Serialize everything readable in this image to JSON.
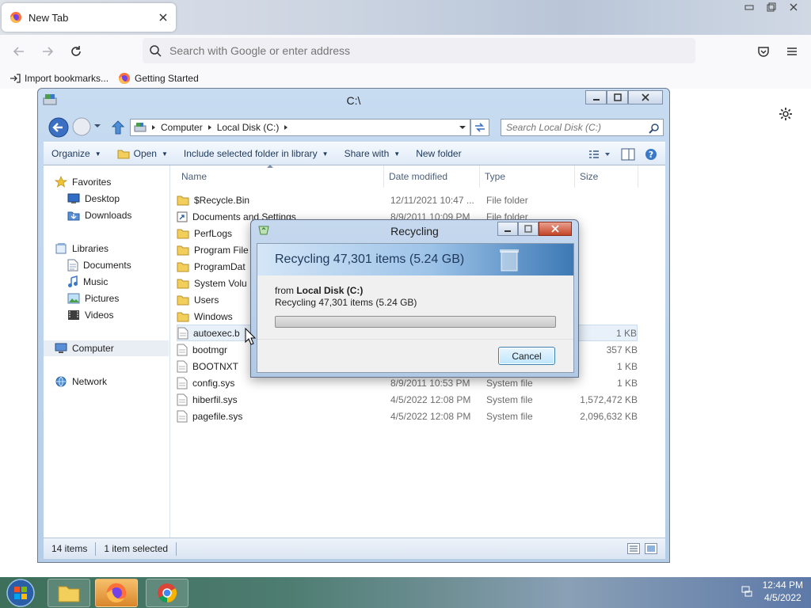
{
  "browser": {
    "tab_title": "New Tab",
    "url_placeholder": "Search with Google or enter address",
    "bookmarks": [
      {
        "label": "Import bookmarks..."
      },
      {
        "label": "Getting Started"
      }
    ]
  },
  "explorer": {
    "title": "C:\\",
    "breadcrumb": [
      "Computer",
      "Local Disk (C:)"
    ],
    "search_placeholder": "Search Local Disk (C:)",
    "toolbar": {
      "organize": "Organize",
      "open": "Open",
      "include": "Include selected folder in library",
      "share": "Share with",
      "new_folder": "New folder"
    },
    "nav": {
      "favorites": "Favorites",
      "desktop": "Desktop",
      "downloads": "Downloads",
      "libraries": "Libraries",
      "documents": "Documents",
      "music": "Music",
      "pictures": "Pictures",
      "videos": "Videos",
      "computer": "Computer",
      "network": "Network"
    },
    "columns": {
      "name": "Name",
      "date": "Date modified",
      "type": "Type",
      "size": "Size"
    },
    "files": [
      {
        "name": "$Recycle.Bin",
        "date": "12/11/2021 10:47 ...",
        "type": "File folder",
        "size": "",
        "icon": "folder"
      },
      {
        "name": "Documents and Settings",
        "date": "8/9/2011 10:09 PM",
        "type": "File folder",
        "size": "",
        "icon": "shortcut"
      },
      {
        "name": "PerfLogs",
        "date": "",
        "type": "",
        "size": "",
        "icon": "folder"
      },
      {
        "name": "Program File",
        "date": "",
        "type": "",
        "size": "",
        "icon": "folder"
      },
      {
        "name": "ProgramDat",
        "date": "",
        "type": "",
        "size": "",
        "icon": "folder"
      },
      {
        "name": "System Volu",
        "date": "",
        "type": "",
        "size": "",
        "icon": "folder"
      },
      {
        "name": "Users",
        "date": "",
        "type": "",
        "size": "",
        "icon": "folder"
      },
      {
        "name": "Windows",
        "date": "",
        "type": "",
        "size": "",
        "icon": "folder"
      },
      {
        "name": "autoexec.b",
        "date": "",
        "type": "",
        "size": "1 KB",
        "icon": "file"
      },
      {
        "name": "bootmgr",
        "date": "",
        "type": "",
        "size": "357 KB",
        "icon": "file"
      },
      {
        "name": "BOOTNXT",
        "date": "",
        "type": "",
        "size": "1 KB",
        "icon": "file"
      },
      {
        "name": "config.sys",
        "date": "8/9/2011 10:53 PM",
        "type": "System file",
        "size": "1 KB",
        "icon": "file"
      },
      {
        "name": "hiberfil.sys",
        "date": "4/5/2022 12:08 PM",
        "type": "System file",
        "size": "1,572,472 KB",
        "icon": "file"
      },
      {
        "name": "pagefile.sys",
        "date": "4/5/2022 12:08 PM",
        "type": "System file",
        "size": "2,096,632 KB",
        "icon": "file"
      }
    ],
    "status": {
      "items": "14 items",
      "selected": "1 item selected"
    }
  },
  "dialog": {
    "title": "Recycling",
    "header": "Recycling 47,301 items (5.24 GB)",
    "from_prefix": "from",
    "from_location": "Local Disk (C:)",
    "detail": "Recycling 47,301 items (5.24 GB)",
    "progress": 0,
    "cancel": "Cancel"
  },
  "taskbar": {
    "time": "12:44 PM",
    "date": "4/5/2022"
  },
  "colors": {
    "accent": "#3c7fb1",
    "progress_green": "#2fb52f"
  }
}
